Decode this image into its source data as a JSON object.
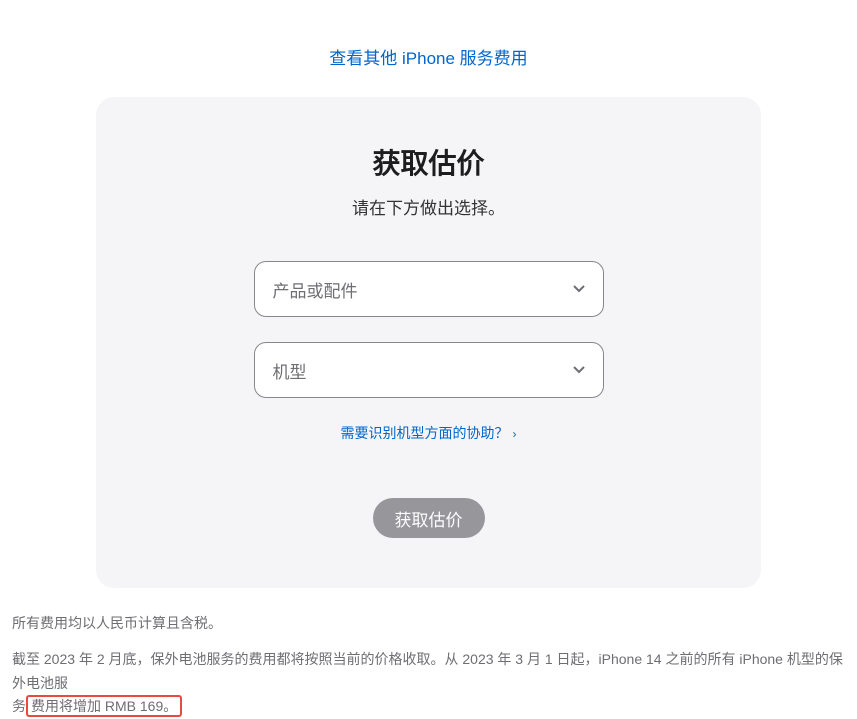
{
  "topLink": "查看其他 iPhone 服务费用",
  "card": {
    "title": "获取估价",
    "subtitle": "请在下方做出选择。",
    "select1": "产品或配件",
    "select2": "机型",
    "helpLink": "需要识别机型方面的协助？",
    "submitButton": "获取估价"
  },
  "footer": {
    "line1": "所有费用均以人民币计算且含税。",
    "line2_part1": "截至 2023 年 2 月底，保外电池服务的费用都将按照当前的价格收取。从 2023 年 3 月 1 日起，iPhone 14 之前的所有 iPhone 机型的保外电池服",
    "line2_part2_prefix": "务",
    "line2_highlighted": "费用将增加 RMB 169。"
  }
}
